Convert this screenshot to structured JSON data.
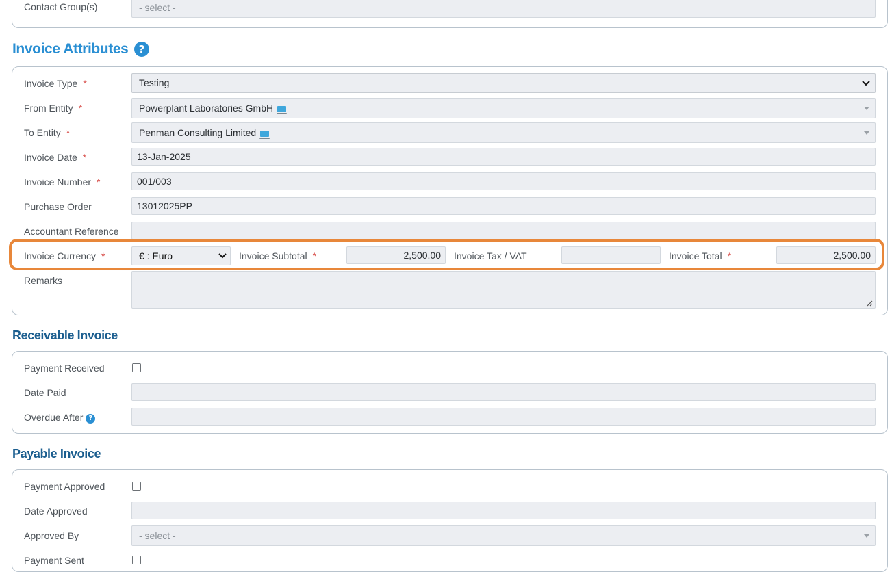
{
  "contact": {
    "groups_label": "Contact Group(s)",
    "groups_value": "- select -"
  },
  "invoice_attributes": {
    "title": "Invoice Attributes",
    "help_icon": "question-circle-icon",
    "type_label": "Invoice Type",
    "type_value": "Testing",
    "from_label": "From Entity",
    "from_value": "Powerplant Laboratories GmbH",
    "to_label": "To Entity",
    "to_value": "Penman Consulting Limited",
    "date_label": "Invoice Date",
    "date_value": "13-Jan-2025",
    "number_label": "Invoice Number",
    "number_value": "001/003",
    "po_label": "Purchase Order",
    "po_value": "13012025PP",
    "accountant_label": "Accountant Reference",
    "accountant_value": "",
    "currency_label": "Invoice Currency",
    "currency_value": "€ : Euro",
    "subtotal_label": "Invoice Subtotal",
    "subtotal_value": "2,500.00",
    "tax_label": "Invoice Tax / VAT",
    "tax_value": "",
    "total_label": "Invoice Total",
    "total_value": "2,500.00",
    "remarks_label": "Remarks",
    "remarks_value": "",
    "required_mark": "*"
  },
  "receivable": {
    "title": "Receivable Invoice",
    "payment_received_label": "Payment Received",
    "payment_received_checked": false,
    "date_paid_label": "Date Paid",
    "date_paid_value": "",
    "overdue_label": "Overdue After",
    "overdue_value": ""
  },
  "payable": {
    "title": "Payable Invoice",
    "payment_approved_label": "Payment Approved",
    "payment_approved_checked": false,
    "date_approved_label": "Date Approved",
    "date_approved_value": "",
    "approved_by_label": "Approved By",
    "approved_by_value": "- select -",
    "payment_sent_label": "Payment Sent",
    "payment_sent_checked": false
  },
  "colors": {
    "section_title": "#1b5e8f",
    "invoice_attributes_title": "#2a8fd3",
    "required": "#d9534f",
    "highlight": "#e8873a",
    "field_bg": "#eceef2"
  }
}
